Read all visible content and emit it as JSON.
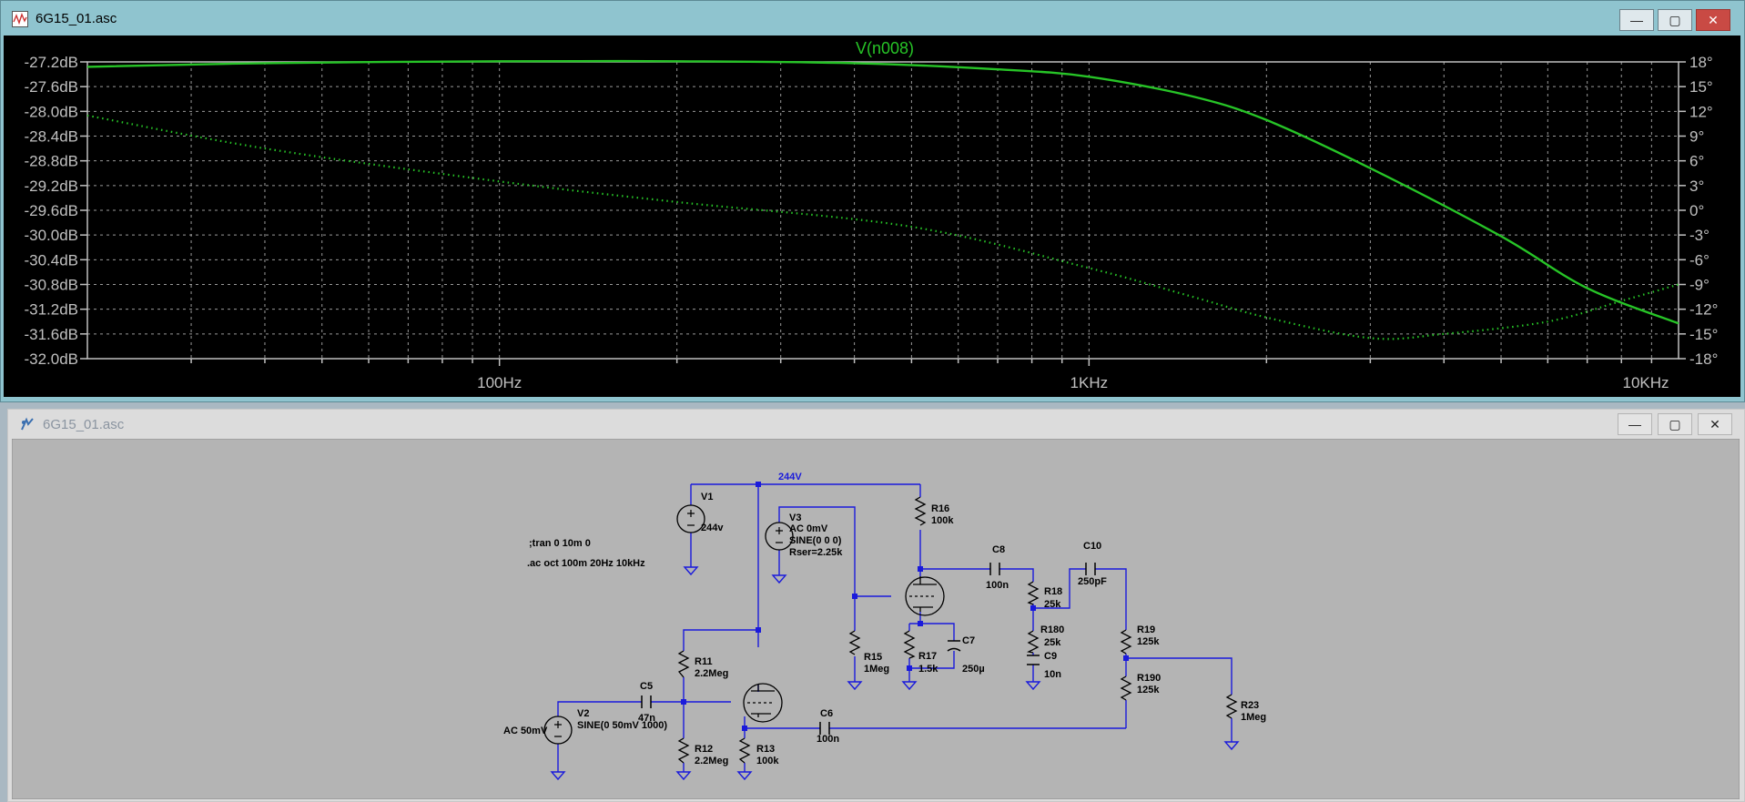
{
  "plot_window": {
    "title": "6G15_01.asc",
    "trace_label": "V(n008)",
    "trace_color": "#27c427",
    "left_ticks": [
      "-27.2dB",
      "-27.6dB",
      "-28.0dB",
      "-28.4dB",
      "-28.8dB",
      "-29.2dB",
      "-29.6dB",
      "-30.0dB",
      "-30.4dB",
      "-30.8dB",
      "-31.2dB",
      "-31.6dB",
      "-32.0dB"
    ],
    "right_ticks": [
      "18°",
      "15°",
      "12°",
      "9°",
      "6°",
      "3°",
      "0°",
      "-3°",
      "-6°",
      "-9°",
      "-12°",
      "-15°",
      "-18°"
    ],
    "x_ticks": [
      "100Hz",
      "1KHz",
      "10KHz"
    ],
    "controls": {
      "minimize": "—",
      "maximize": "▢",
      "close": "✕"
    }
  },
  "chart_data": {
    "type": "line",
    "x_scale": "log",
    "xlim": [
      20,
      10000
    ],
    "ylim": [
      -32.0,
      -27.2
    ],
    "y2lim": [
      -18,
      18
    ],
    "grid": true,
    "series": [
      {
        "name": "V(n008)",
        "style": "solid",
        "axis": "magnitude_dB",
        "x": [
          20,
          40,
          100,
          200,
          400,
          700,
          1000,
          1500,
          2000,
          3000,
          5000,
          7000,
          10000
        ],
        "y": [
          -27.28,
          -27.22,
          -27.19,
          -27.19,
          -27.22,
          -27.32,
          -27.44,
          -27.76,
          -28.14,
          -28.92,
          -30.02,
          -30.86,
          -31.43
        ]
      },
      {
        "style": "dotted",
        "axis": "phase_deg",
        "x": [
          20,
          40,
          100,
          200,
          500,
          1000,
          1500,
          2000,
          3000,
          4000,
          6000,
          8000,
          10000
        ],
        "y": [
          11.5,
          7.5,
          3.5,
          1.0,
          -2.0,
          -7.0,
          -10.5,
          -13.0,
          -15.5,
          -15.0,
          -13.5,
          -11.0,
          -9.0
        ]
      }
    ]
  },
  "schematic_window": {
    "title": "6G15_01.asc",
    "controls": {
      "minimize": "—",
      "maximize": "▢",
      "close": "✕"
    },
    "directives": [
      ";tran 0 10m 0",
      ".ac oct 100m 20Hz 10kHz"
    ],
    "net_label": "244V",
    "components": {
      "V1": {
        "name": "V1",
        "value": "244v"
      },
      "V2": {
        "name": "V2",
        "value": "SINE(0 50mV 1000)",
        "ac": "AC 50mV"
      },
      "V3": {
        "name": "V3",
        "value1": "AC 0mV",
        "value2": "SINE(0 0 0)",
        "value3": "Rser=2.25k"
      },
      "R11": {
        "name": "R11",
        "value": "2.2Meg"
      },
      "R12": {
        "name": "R12",
        "value": "2.2Meg"
      },
      "R13": {
        "name": "R13",
        "value": "100k"
      },
      "R15": {
        "name": "R15",
        "value": "1Meg"
      },
      "R16": {
        "name": "R16",
        "value": "100k"
      },
      "R17": {
        "name": "R17",
        "value": "1.5k"
      },
      "R18": {
        "name": "R18",
        "value": "25k"
      },
      "R180": {
        "name": "R180",
        "value": "25k"
      },
      "R19": {
        "name": "R19",
        "value": "125k"
      },
      "R190": {
        "name": "R190",
        "value": "125k"
      },
      "R23": {
        "name": "R23",
        "value": "1Meg"
      },
      "C5": {
        "name": "C5",
        "value": "47n"
      },
      "C6": {
        "name": "C6",
        "value": "100n"
      },
      "C7": {
        "name": "C7",
        "value": "250µ"
      },
      "C8": {
        "name": "C8",
        "value": "100n"
      },
      "C9": {
        "name": "C9",
        "value": "10n"
      },
      "C10": {
        "name": "C10",
        "value": "250pF"
      }
    }
  }
}
